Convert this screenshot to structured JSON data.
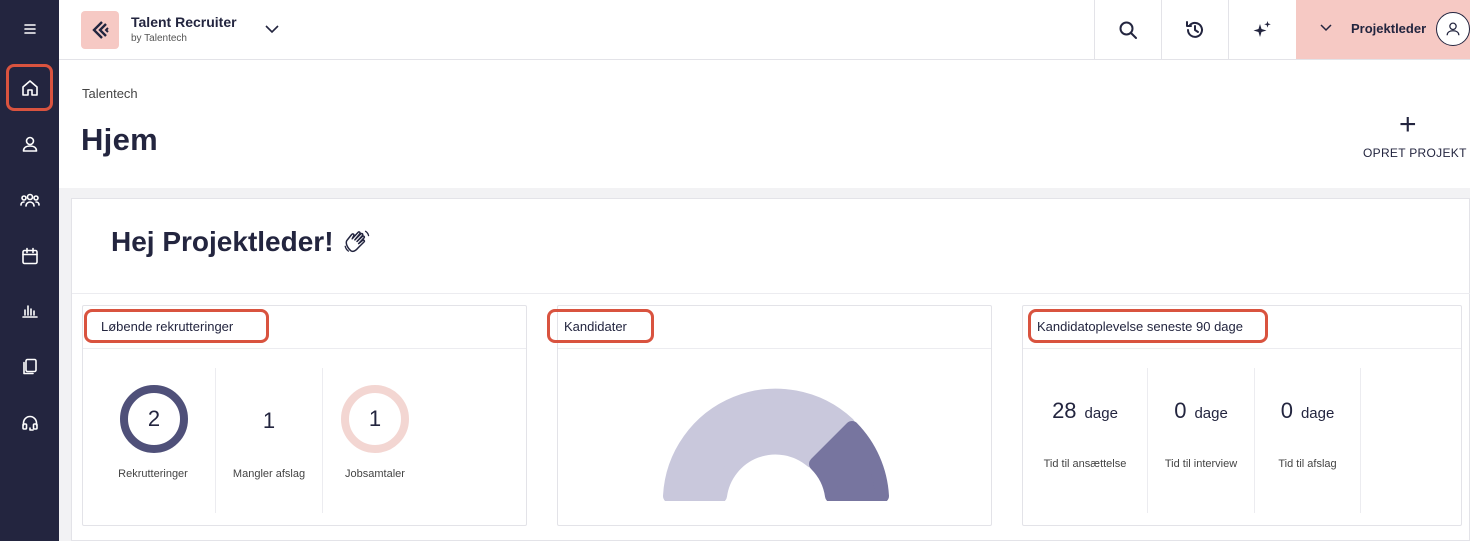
{
  "header": {
    "app_title": "Talent Recruiter",
    "app_subtitle": "by Talentech",
    "user_name": "Projektleder"
  },
  "page": {
    "breadcrumb": "Talentech",
    "title": "Hjem",
    "create_label": "OPRET PROJEKT"
  },
  "greeting": "Hej Projektleder!",
  "recruitments": {
    "title": "Løbende rekrutteringer",
    "stats": [
      {
        "value": "2",
        "label": "Rekrutteringer"
      },
      {
        "value": "1",
        "label": "Mangler afslag"
      },
      {
        "value": "1",
        "label": "Jobsamtaler"
      }
    ]
  },
  "candidates": {
    "title": "Kandidater",
    "gauge_colors": {
      "track": "#c9c8dc",
      "fill": "#77759f"
    }
  },
  "experience": {
    "title": "Kandidatoplevelse seneste 90 dage",
    "unit": "dage",
    "stats": [
      {
        "value": "28",
        "label": "Tid til ansættelse"
      },
      {
        "value": "0",
        "label": "Tid til interview"
      },
      {
        "value": "0",
        "label": "Tid til afslag"
      }
    ]
  },
  "colors": {
    "sidebar": "#23253f",
    "accent_pink": "#f6c9c4",
    "highlight": "#d9533f",
    "ring_dark": "#4f5079",
    "ring_light": "#f3d6d2"
  }
}
